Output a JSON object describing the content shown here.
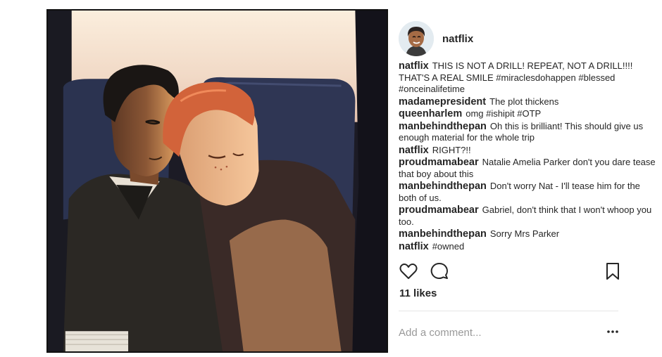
{
  "post": {
    "header": {
      "username": "natflix",
      "avatar_icon": "profile-avatar"
    },
    "comments": [
      {
        "user": "natflix",
        "text": "THIS IS NOT A DRILL! REPEAT, NOT A DRILL!!!! THAT'S A REAL SMILE #miraclesdohappen #blessed #onceinalifetime"
      },
      {
        "user": "madamepresident",
        "text": "The plot thickens"
      },
      {
        "user": "queenharlem",
        "text": "omg #ishipit #OTP"
      },
      {
        "user": "manbehindthepan",
        "text": "Oh this is brilliant! This should give us enough material for the whole trip"
      },
      {
        "user": "natflix",
        "text": "RIGHT?!!"
      },
      {
        "user": "proudmamabear",
        "text": "Natalie Amelia Parker don't you dare tease that boy about this"
      },
      {
        "user": "manbehindthepan",
        "text": "Don't worry Nat - I'll tease him for the both of us."
      },
      {
        "user": "proudmamabear",
        "text": "Gabriel, don't think that I won't whoop you too."
      },
      {
        "user": "manbehindthepan",
        "text": "Sorry Mrs Parker"
      },
      {
        "user": "natflix",
        "text": "#owned"
      }
    ],
    "actions": {
      "like_icon": "heart-icon",
      "comment_icon": "comment-bubble-icon",
      "save_icon": "bookmark-icon"
    },
    "likes_text": "11 likes",
    "add_comment_placeholder": "Add a comment...",
    "more_icon": "more-options-icon"
  },
  "colors": {
    "text": "#262626",
    "placeholder": "#999999",
    "divider": "#e6e6e6",
    "sky": "#f2dcc8",
    "seat": "#2b3350"
  }
}
